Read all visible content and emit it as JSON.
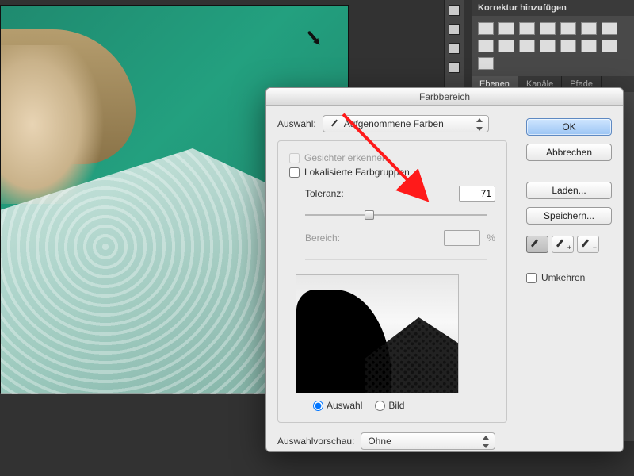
{
  "panels": {
    "adjust_title": "Korrektur hinzufügen",
    "tabs": [
      "Ebenen",
      "Kanäle",
      "Pfade"
    ],
    "active_tab": 0
  },
  "dialog": {
    "title": "Farbbereich",
    "select_label": "Auswahl:",
    "select_value": "Aufgenommene Farben",
    "detect_faces": "Gesichter erkennen",
    "localized": "Lokalisierte Farbgruppen",
    "tolerance_label": "Toleranz:",
    "tolerance_value": "71",
    "range_label": "Bereich:",
    "range_value": "",
    "range_suffix": "%",
    "radio_selection": "Auswahl",
    "radio_image": "Bild",
    "preview_label": "Auswahlvorschau:",
    "preview_value": "Ohne",
    "buttons": {
      "ok": "OK",
      "cancel": "Abbrechen",
      "load": "Laden...",
      "save": "Speichern..."
    },
    "invert": "Umkehren"
  }
}
